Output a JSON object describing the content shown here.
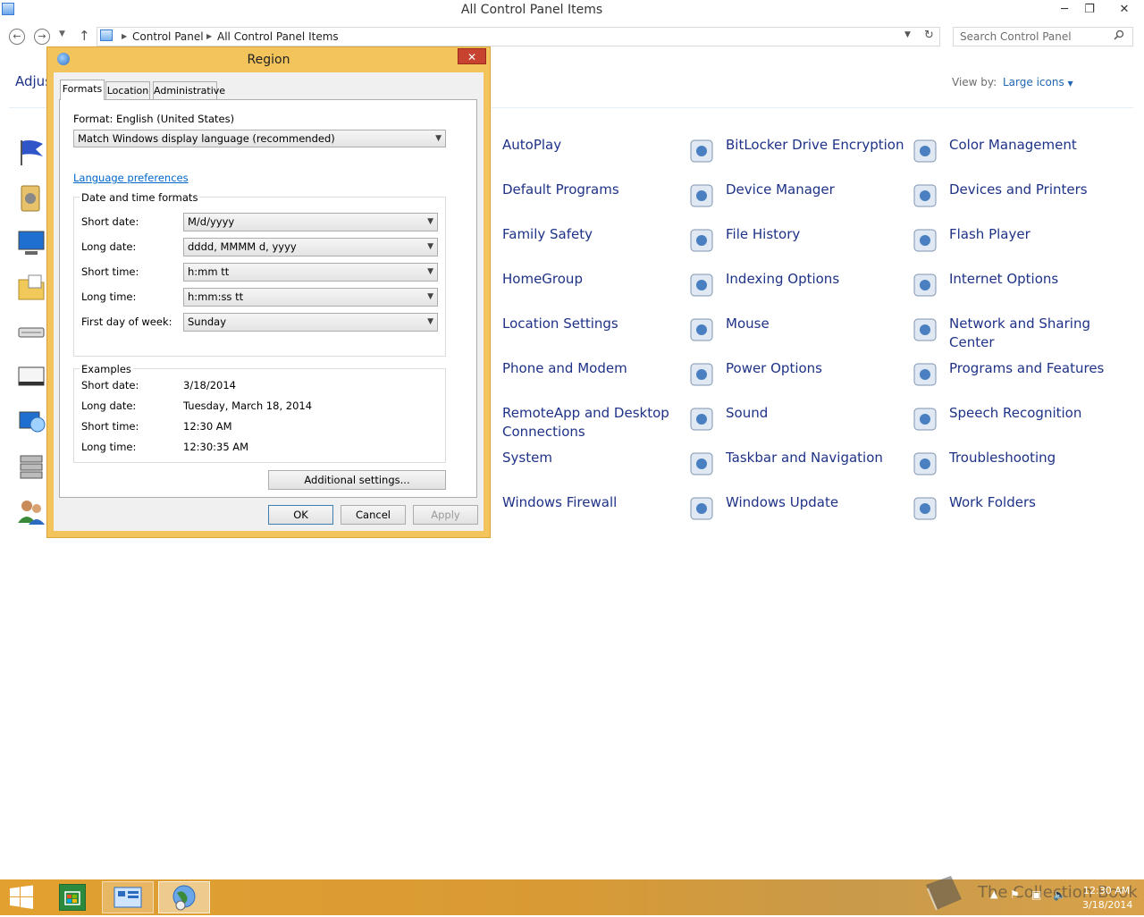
{
  "window": {
    "title": "All Control Panel Items",
    "minimize_glyph": "─",
    "maximize_glyph": "❐",
    "close_glyph": "✕"
  },
  "address": {
    "crumbs": [
      "Control Panel",
      "All Control Panel Items"
    ],
    "search_placeholder": "Search Control Panel"
  },
  "content": {
    "title": "Adjus",
    "view_by_label": "View by:",
    "view_by_value": "Large icons"
  },
  "items": [
    {
      "label": "AutoPlay",
      "icon": "autoplay-icon"
    },
    {
      "label": "BitLocker Drive Encryption",
      "icon": "bitlocker-icon"
    },
    {
      "label": "Color Management",
      "icon": "color-management-icon"
    },
    {
      "label": "Default Programs",
      "icon": "default-programs-icon"
    },
    {
      "label": "Device Manager",
      "icon": "device-manager-icon"
    },
    {
      "label": "Devices and Printers",
      "icon": "printer-icon"
    },
    {
      "label": "Family Safety",
      "icon": "family-safety-icon"
    },
    {
      "label": "File History",
      "icon": "folder-clock-icon"
    },
    {
      "label": "Flash Player",
      "icon": "flash-icon"
    },
    {
      "label": "HomeGroup",
      "icon": "homegroup-icon"
    },
    {
      "label": "Indexing Options",
      "icon": "magnifier-icon"
    },
    {
      "label": "Internet Options",
      "icon": "globe-icon"
    },
    {
      "label": "Location Settings",
      "icon": "location-icon"
    },
    {
      "label": "Mouse",
      "icon": "mouse-icon"
    },
    {
      "label": "Network and Sharing Center",
      "icon": "network-icon"
    },
    {
      "label": "Phone and Modem",
      "icon": "phone-icon"
    },
    {
      "label": "Power Options",
      "icon": "battery-icon"
    },
    {
      "label": "Programs and Features",
      "icon": "programs-icon"
    },
    {
      "label": "RemoteApp and Desktop Connections",
      "icon": "remoteapp-icon"
    },
    {
      "label": "Sound",
      "icon": "speaker-icon"
    },
    {
      "label": "Speech Recognition",
      "icon": "microphone-icon"
    },
    {
      "label": "System",
      "icon": "system-icon"
    },
    {
      "label": "Taskbar and Navigation",
      "icon": "taskbar-icon"
    },
    {
      "label": "Troubleshooting",
      "icon": "troubleshooting-icon"
    },
    {
      "label": "Windows Firewall",
      "icon": "firewall-icon"
    },
    {
      "label": "Windows Update",
      "icon": "update-icon"
    },
    {
      "label": "Work Folders",
      "icon": "work-folders-icon"
    }
  ],
  "dialog": {
    "title": "Region",
    "close_glyph": "✕",
    "tabs": [
      "Formats",
      "Location",
      "Administrative"
    ],
    "format_label": "Format: English (United States)",
    "format_value": "Match Windows display language (recommended)",
    "language_link": "Language preferences",
    "formats_group_title": "Date and time formats",
    "fields": [
      {
        "label": "Short date:",
        "value": "M/d/yyyy"
      },
      {
        "label": "Long date:",
        "value": "dddd, MMMM d, yyyy"
      },
      {
        "label": "Short time:",
        "value": "h:mm tt"
      },
      {
        "label": "Long time:",
        "value": "h:mm:ss tt"
      },
      {
        "label": "First day of week:",
        "value": "Sunday"
      }
    ],
    "examples_title": "Examples",
    "examples": [
      {
        "label": "Short date:",
        "value": "3/18/2014"
      },
      {
        "label": "Long date:",
        "value": "Tuesday, March 18, 2014"
      },
      {
        "label": "Short time:",
        "value": "12:30 AM"
      },
      {
        "label": "Long time:",
        "value": "12:30:35 AM"
      }
    ],
    "additional_button": "Additional settings...",
    "ok_button": "OK",
    "cancel_button": "Cancel",
    "apply_button": "Apply"
  },
  "taskbar": {
    "watermark": "The Collection Book",
    "clock_time": "12:30 AM",
    "clock_date": "3/18/2014"
  },
  "colors": {
    "accent_dialog": "#f2c45b",
    "link": "#1e3287",
    "taskbar": "#d89a35"
  }
}
